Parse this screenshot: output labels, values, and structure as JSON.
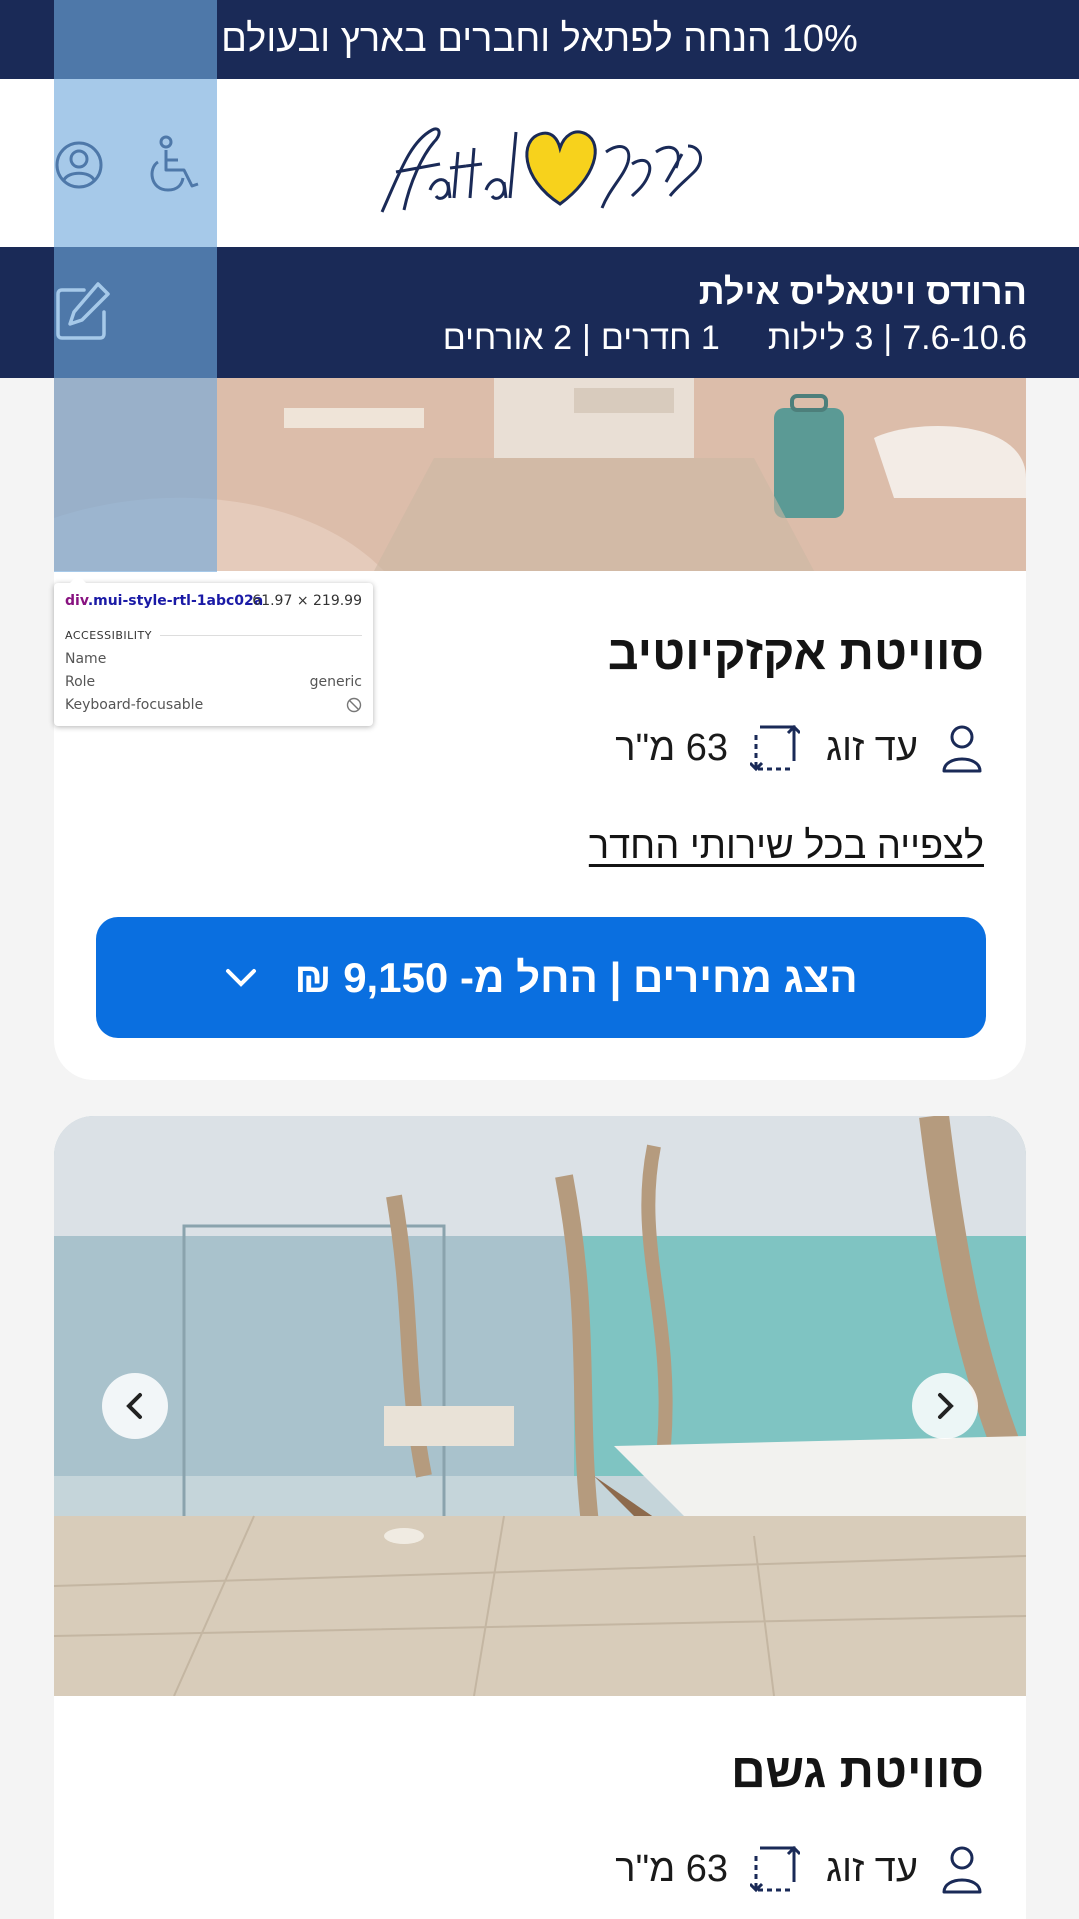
{
  "promo": {
    "text": "10% הנחה לפתאל וחברים בארץ ובעולם"
  },
  "header": {
    "logo_text": "fattal פתאל",
    "icons": [
      "user-icon",
      "accessibility-icon"
    ]
  },
  "booking": {
    "hotel_name": "הרודס ויטאליס אילת",
    "dates": "7.6-10.6",
    "nights": "3 לילות",
    "rooms": "1 חדרים",
    "guests": "2 אורחים",
    "edit_icon": "edit-icon"
  },
  "rooms": [
    {
      "title": "סוויטת אקזקיוטיב",
      "occupancy": "עד זוג",
      "size": "63 מ\"ר",
      "services_link": "לצפייה בכל שירותי החדר",
      "price_button": "הצג מחירים | החל מ- 9,150 ₪"
    },
    {
      "title": "סוויטת גשם",
      "occupancy": "עד זוג",
      "size": "63 מ\"ר"
    }
  ],
  "devtools": {
    "selector_tag": "div",
    "selector_class": ".mui-style-rtl-1abc02a",
    "dimensions": "61.97 × 219.99",
    "section": "ACCESSIBILITY",
    "rows": [
      {
        "label": "Name",
        "value": ""
      },
      {
        "label": "Role",
        "value": "generic"
      },
      {
        "label": "Keyboard-focusable",
        "value": ""
      }
    ]
  },
  "colors": {
    "navy": "#1a2a57",
    "button_blue": "#0a6fe0",
    "logo_yellow": "#f7d21c",
    "highlight": "#6fa8dc"
  }
}
